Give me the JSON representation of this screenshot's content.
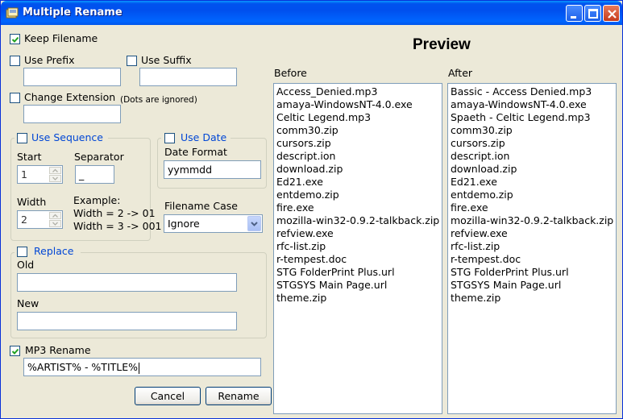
{
  "window": {
    "title": "Multiple Rename"
  },
  "options": {
    "keep_filename": {
      "label": "Keep Filename",
      "checked": true
    },
    "use_prefix": {
      "label": "Use Prefix",
      "checked": false,
      "value": ""
    },
    "use_suffix": {
      "label": "Use Suffix",
      "checked": false,
      "value": ""
    },
    "change_extension": {
      "label": "Change Extension",
      "checked": false,
      "note": "(Dots are ignored)",
      "value": ""
    }
  },
  "sequence": {
    "label": "Use  Sequence",
    "start_label": "Start",
    "start_value": "1",
    "separator_label": "Separator",
    "separator_value": "_",
    "width_label": "Width",
    "width_value": "2",
    "example_title": "Example:",
    "example_line1": "Width = 2 ->  01",
    "example_line2": "Width = 3 ->  001"
  },
  "date": {
    "label": "Use Date",
    "format_label": "Date Format",
    "format_value": "yymmdd"
  },
  "filename_case": {
    "label": "Filename Case",
    "selected": "Ignore"
  },
  "replace": {
    "label": "Replace",
    "old_label": "Old",
    "old_value": "",
    "new_label": "New",
    "new_value": ""
  },
  "mp3": {
    "label": "MP3 Rename",
    "checked": true,
    "value": "%ARTIST% - %TITLE%"
  },
  "buttons": {
    "cancel": "Cancel",
    "rename": "Rename"
  },
  "preview": {
    "title": "Preview",
    "before_label": "Before",
    "after_label": "After",
    "before": [
      "Access_Denied.mp3",
      "amaya-WindowsNT-4.0.exe",
      "Celtic Legend.mp3",
      "comm30.zip",
      "cursors.zip",
      "descript.ion",
      "download.zip",
      "Ed21.exe",
      "entdemo.zip",
      "fire.exe",
      "mozilla-win32-0.9.2-talkback.zip",
      "refview.exe",
      "rfc-list.zip",
      "r-tempest.doc",
      "STG FolderPrint Plus.url",
      "STGSYS Main Page.url",
      "theme.zip"
    ],
    "after": [
      "Bassic - Access Denied.mp3",
      "amaya-WindowsNT-4.0.exe",
      "Spaeth - Celtic Legend.mp3",
      "comm30.zip",
      "cursors.zip",
      "descript.ion",
      "download.zip",
      "Ed21.exe",
      "entdemo.zip",
      "fire.exe",
      "mozilla-win32-0.9.2-talkback.zip",
      "refview.exe",
      "rfc-list.zip",
      "r-tempest.doc",
      "STG FolderPrint Plus.url",
      "STGSYS Main Page.url",
      "theme.zip"
    ]
  }
}
